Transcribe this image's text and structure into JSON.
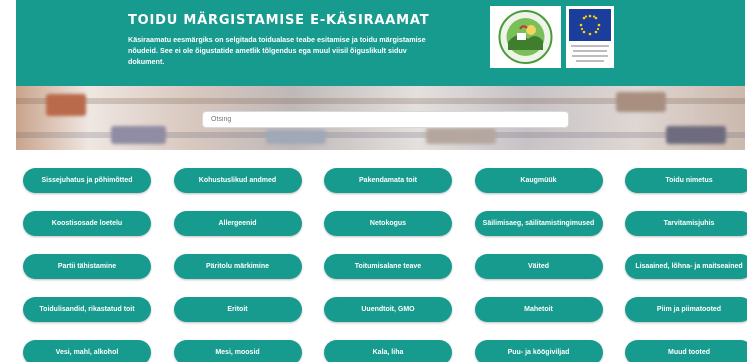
{
  "header": {
    "title": "TOIDU MÄRGISTAMISE E-KÄSIRAAMAT",
    "subtitle": "Käsiraamatu eesmärgiks on selgitada toidualase teabe esitamise ja toidu märgistamise nõudeid. See ei ole õigustatide ametlik tõlgendus ega muul viisil õiguslikult siduv dokument.",
    "eu_caption": "Euroopa Maaelu Arengu Põllumajandusfond: Euroopa investeeringud maapiirkondadesse"
  },
  "search": {
    "placeholder": "Otsing"
  },
  "categories": [
    "Sissejuhatus ja põhimõtted",
    "Kohustuslikud andmed",
    "Pakendamata toit",
    "Kaugmüük",
    "Toidu nimetus",
    "Koostisosade loetelu",
    "Allergeenid",
    "Netokogus",
    "Säilimisaeg, säilitamistingimused",
    "Tarvitamisjuhis",
    "Partii tähistamine",
    "Päritolu märkimine",
    "Toitumisalane teave",
    "Väited",
    "Lisaained, lõhna- ja maitseained",
    "Toidulisandid, rikastatud toit",
    "Eritoit",
    "Uuendtoit, GMO",
    "Mahetoit",
    "Piim ja piimatooted",
    "Vesi, mahl, alkohol",
    "Mesi, moosid",
    "Kala, liha",
    "Puu- ja köögiviljad",
    "Muud tooted"
  ],
  "colors": {
    "primary": "#179b8e",
    "text_on_primary": "#ffffff",
    "eu_blue": "#1b3d9c",
    "eu_star": "#ffd200"
  },
  "icons": {
    "quality_logo": "quality-seal-logo",
    "eu_logo": "eu-flag-logo"
  }
}
